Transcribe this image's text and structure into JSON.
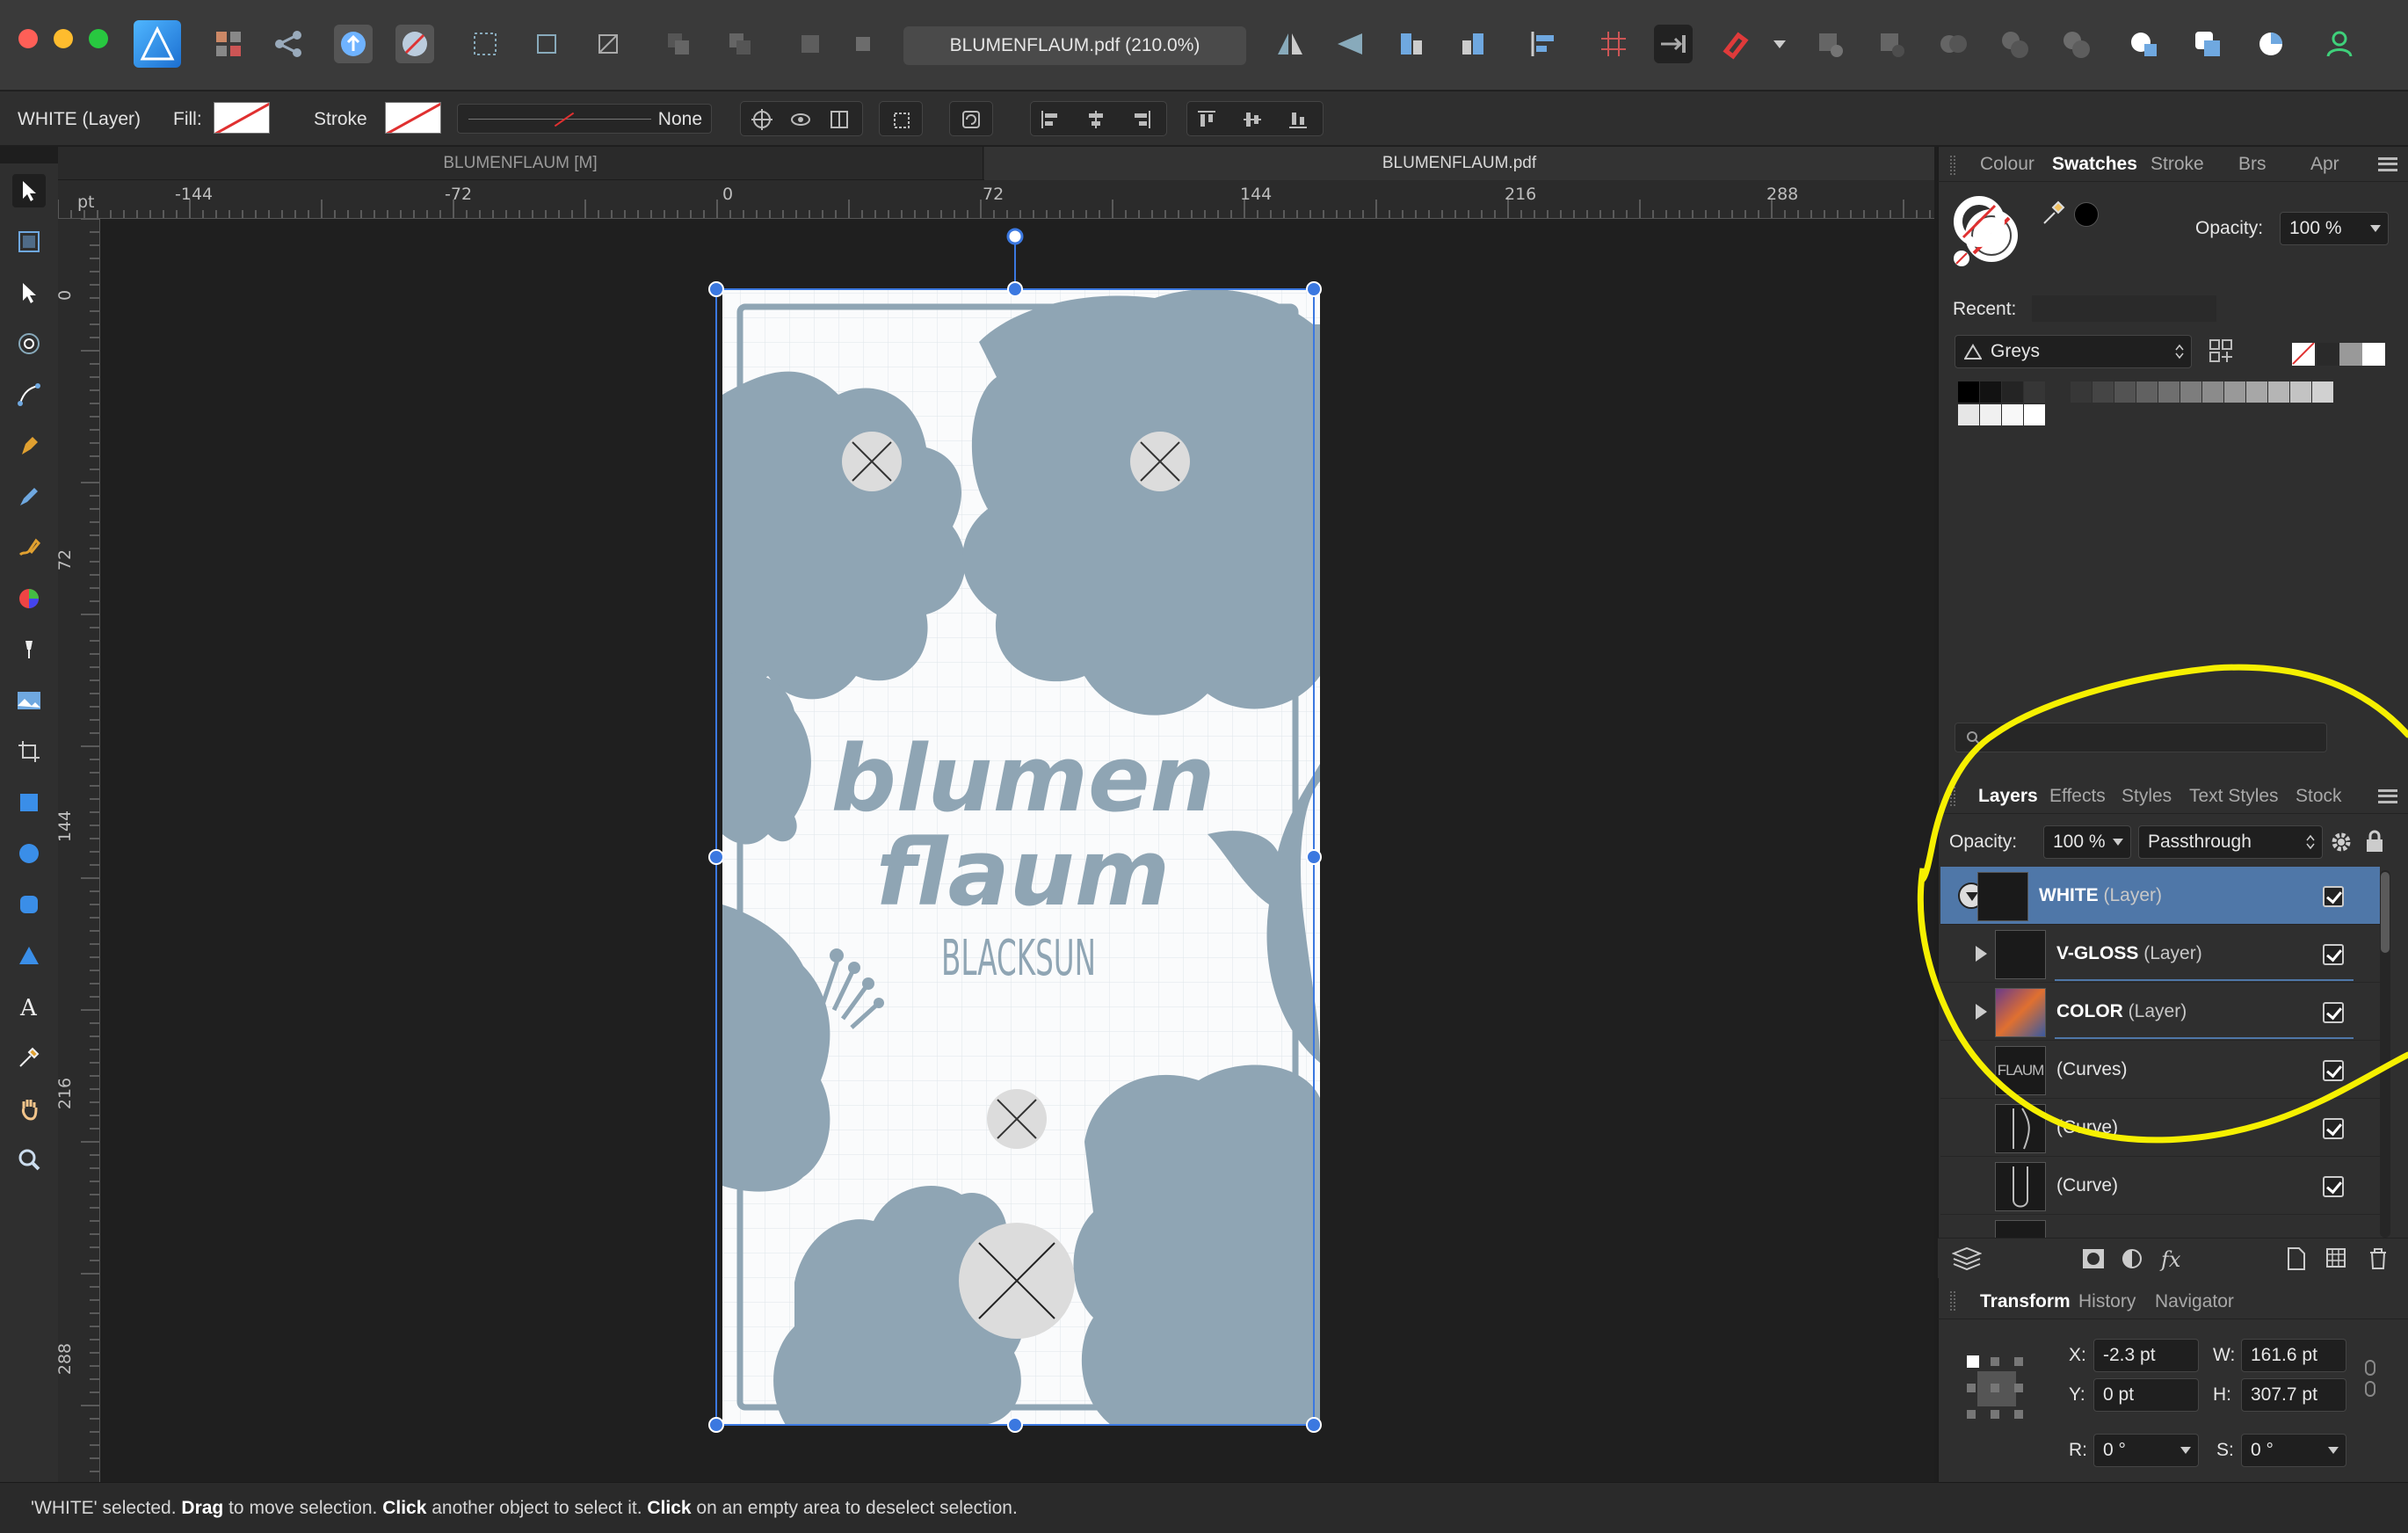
{
  "window": {
    "document_title": "BLUMENFLAUM.pdf (210.0%)"
  },
  "context_toolbar": {
    "selection_label": "WHITE (Layer)",
    "fill_label": "Fill:",
    "stroke_label": "Stroke",
    "stroke_style_value": "None"
  },
  "document_tabs": [
    {
      "label": "BLUMENFLAUM [M]"
    },
    {
      "label": "BLUMENFLAUM.pdf"
    }
  ],
  "ruler": {
    "unit": "pt",
    "h_ticks": [
      "-144",
      "-72",
      "0",
      "72",
      "144",
      "216",
      "288"
    ],
    "v_ticks": [
      "0",
      "72",
      "144",
      "216",
      "288"
    ]
  },
  "artwork": {
    "title_line1": "blumen",
    "title_line2": "flaum",
    "subtitle": "BLACKSUN"
  },
  "swatch_panel": {
    "tabs": [
      "Colour",
      "Swatches",
      "Stroke",
      "Brs",
      "Apr"
    ],
    "active_tab": "Swatches",
    "opacity_label": "Opacity:",
    "opacity_value": "100 %",
    "recent_label": "Recent:",
    "palette_name": "Greys"
  },
  "layers_panel": {
    "tabs": [
      "Layers",
      "Effects",
      "Styles",
      "Text Styles",
      "Stock"
    ],
    "active_tab": "Layers",
    "opacity_label": "Opacity:",
    "opacity_value": "100 %",
    "blend_mode": "Passthrough",
    "layers": [
      {
        "name": "WHITE",
        "kind": "(Layer)"
      },
      {
        "name": "V-GLOSS",
        "kind": "(Layer)"
      },
      {
        "name": "COLOR",
        "kind": "(Layer)"
      },
      {
        "name": "",
        "kind": "(Curves)",
        "thumb_text": "FLAUM"
      },
      {
        "name": "",
        "kind": "(Curve)"
      },
      {
        "name": "",
        "kind": "(Curve)"
      }
    ]
  },
  "transform_panel": {
    "tabs": [
      "Transform",
      "History",
      "Navigator"
    ],
    "active_tab": "Transform",
    "x_label": "X:",
    "x_value": "-2.3 pt",
    "y_label": "Y:",
    "y_value": "0 pt",
    "w_label": "W:",
    "w_value": "161.6 pt",
    "h_label": "H:",
    "h_value": "307.7 pt",
    "r_label": "R:",
    "r_value": "0 °",
    "s_label": "S:",
    "s_value": "0 °"
  },
  "status": {
    "part1": "'WHITE' selected. ",
    "b1": "Drag",
    "part2": " to move selection. ",
    "b2": "Click",
    "part3": " another object to select it. ",
    "b3": "Click",
    "part4": " on an empty area to deselect selection."
  },
  "colors": {
    "accent": "#4f77a8",
    "artwork_shape": "#8fa5b4",
    "annotation": "#f6f000"
  }
}
